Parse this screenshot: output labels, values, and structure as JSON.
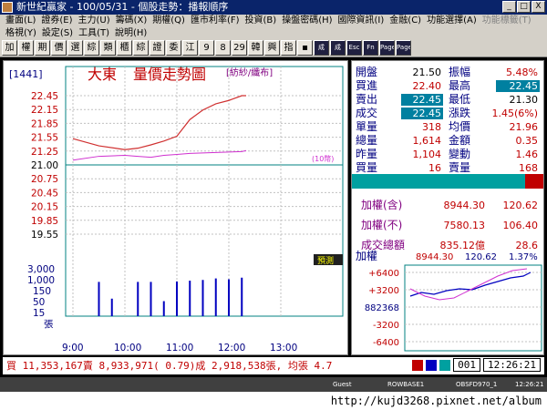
{
  "window": {
    "title": "新世紀贏家 - 100/05/31 - 個股走勢：播報順序",
    "controls": [
      "_",
      "□",
      "X"
    ]
  },
  "menu": [
    {
      "label": "畫面(L)",
      "enabled": true
    },
    {
      "label": "證券(E)",
      "enabled": true
    },
    {
      "label": "主力(U)",
      "enabled": true
    },
    {
      "label": "籌碼(X)",
      "enabled": true
    },
    {
      "label": "期權(Q)",
      "enabled": true
    },
    {
      "label": "匯市利率(F)",
      "enabled": true
    },
    {
      "label": "投資(B)",
      "enabled": true
    },
    {
      "label": "操盤密碼(H)",
      "enabled": true
    },
    {
      "label": "國際資訊(I)",
      "enabled": true
    },
    {
      "label": "金融(C)",
      "enabled": true
    },
    {
      "label": "功能選擇(A)",
      "enabled": true
    },
    {
      "label": "功能標籤(T)",
      "enabled": false
    }
  ],
  "submenu": [
    "格視(Y)",
    "設定(S)",
    "工具(T)",
    "說明(H)"
  ],
  "toolbar": [
    "加",
    "權",
    "期",
    "價",
    "選",
    "綜",
    "類",
    "櫃",
    "綜",
    "證",
    "委",
    "江",
    "9",
    "8",
    "29",
    "韓",
    "興",
    "指",
    "▪",
    "成",
    "成",
    "Esc",
    "Fn",
    "Page",
    "Page"
  ],
  "stock": {
    "code": "[1441]",
    "name": "大東",
    "title": "量價走勢圖",
    "category": "[紡紗/纖布]"
  },
  "price_axis": [
    "22.45",
    "22.15",
    "21.85",
    "21.55",
    "21.25",
    "21.00",
    "20.75",
    "20.45",
    "20.15",
    "19.85",
    "19.55"
  ],
  "avg_label": "(10幣)",
  "predict_label": "預測",
  "volume_axis": [
    "3,000",
    "1,000",
    "150",
    "50",
    "15",
    "張"
  ],
  "time_axis": [
    "9:00",
    "10:00",
    "11:00",
    "12:00",
    "13:00"
  ],
  "quotes": [
    {
      "l1": "開盤",
      "v1": "21.50",
      "l2": "振幅",
      "v2": "5.48%",
      "c1": "#000",
      "c2": "#c00000"
    },
    {
      "l1": "買進",
      "v1": "22.40",
      "l2": "最高",
      "v2": "22.45",
      "c1": "#c00000",
      "c2": "#fff",
      "bg2": "#0080a0"
    },
    {
      "l1": "賣出",
      "v1": "22.45",
      "l2": "最低",
      "v2": "21.30",
      "c1": "#fff",
      "bg1": "#0080a0",
      "c2": "#000"
    },
    {
      "l1": "成交",
      "v1": "22.45",
      "l2": "漲跌",
      "v2": "1.45(6%)",
      "c1": "#fff",
      "bg1": "#0080a0",
      "c2": "#c00000"
    },
    {
      "l1": "單量",
      "v1": "318",
      "l2": "均價",
      "v2": "21.96",
      "c1": "#c00000",
      "c2": "#c00000"
    },
    {
      "l1": "總量",
      "v1": "1,614",
      "l2": "金額",
      "v2": "0.35",
      "c1": "#c00000",
      "c2": "#c00000"
    },
    {
      "l1": "昨量",
      "v1": "1,104",
      "l2": "變動",
      "v2": "1.46",
      "c1": "#c00000",
      "c2": "#c00000"
    },
    {
      "l1": "買量",
      "v1": "16",
      "l2": "賣量",
      "v2": "168",
      "c1": "#c00000",
      "c2": "#c00000"
    }
  ],
  "index": [
    {
      "label": "加權(含)",
      "v1": "8944.30",
      "v2": "120.62"
    },
    {
      "label": "加權(不)",
      "v1": "7580.13",
      "v2": "106.40"
    },
    {
      "label": "成交總額",
      "v1": "835.12億",
      "v2": "28.6"
    }
  ],
  "mini": {
    "label": "加權",
    "value": "8944.30",
    "change": "120.62",
    "pct": "1.37%",
    "axis": [
      "+6400",
      "+3200",
      "882368",
      "-3200",
      "-6400"
    ]
  },
  "summary": "買 11,353,167賣 8,933,971( 0.79)成 2,918,538張, 均張 4.7",
  "summary_box": "001",
  "clock": "12:26:21",
  "status": [
    "Guest",
    "ROWBASE1",
    "OBSFD970_1",
    "12:26:21"
  ],
  "watermark": "http://kujd3268.pixnet.net/album",
  "chart_data": {
    "type": "line",
    "x": [
      "9:00",
      "9:30",
      "10:00",
      "10:15",
      "10:30",
      "10:45",
      "11:00",
      "11:15",
      "11:30",
      "11:45",
      "12:00",
      "12:15",
      "12:20"
    ],
    "series": [
      {
        "values": [
          21.55,
          21.4,
          21.32,
          21.35,
          21.42,
          21.5,
          21.6,
          21.95,
          22.15,
          22.28,
          22.35,
          22.45,
          22.45
        ],
        "color": "#d03030"
      },
      {
        "values": [
          21.1,
          21.18,
          21.2,
          21.18,
          21.16,
          21.2,
          21.22,
          21.24,
          21.25,
          21.26,
          21.27,
          21.28,
          21.3
        ],
        "color": "#d030d0"
      }
    ],
    "volume": [
      {
        "time": "9:30",
        "value": 150
      },
      {
        "time": "9:45",
        "value": 12
      },
      {
        "time": "10:15",
        "value": 150
      },
      {
        "time": "10:30",
        "value": 150
      },
      {
        "time": "10:45",
        "value": 8
      },
      {
        "time": "11:00",
        "value": 160
      },
      {
        "time": "11:15",
        "value": 180
      },
      {
        "time": "11:30",
        "value": 200
      },
      {
        "time": "11:45",
        "value": 250
      },
      {
        "time": "12:00",
        "value": 220
      },
      {
        "time": "12:15",
        "value": 280
      }
    ],
    "ylim": [
      19.55,
      22.45
    ],
    "ref_price": 21.0
  },
  "colors": {
    "accent": "#0080a0",
    "up": "#c00000",
    "down": "#008000",
    "panel": "#d4d0c8"
  }
}
